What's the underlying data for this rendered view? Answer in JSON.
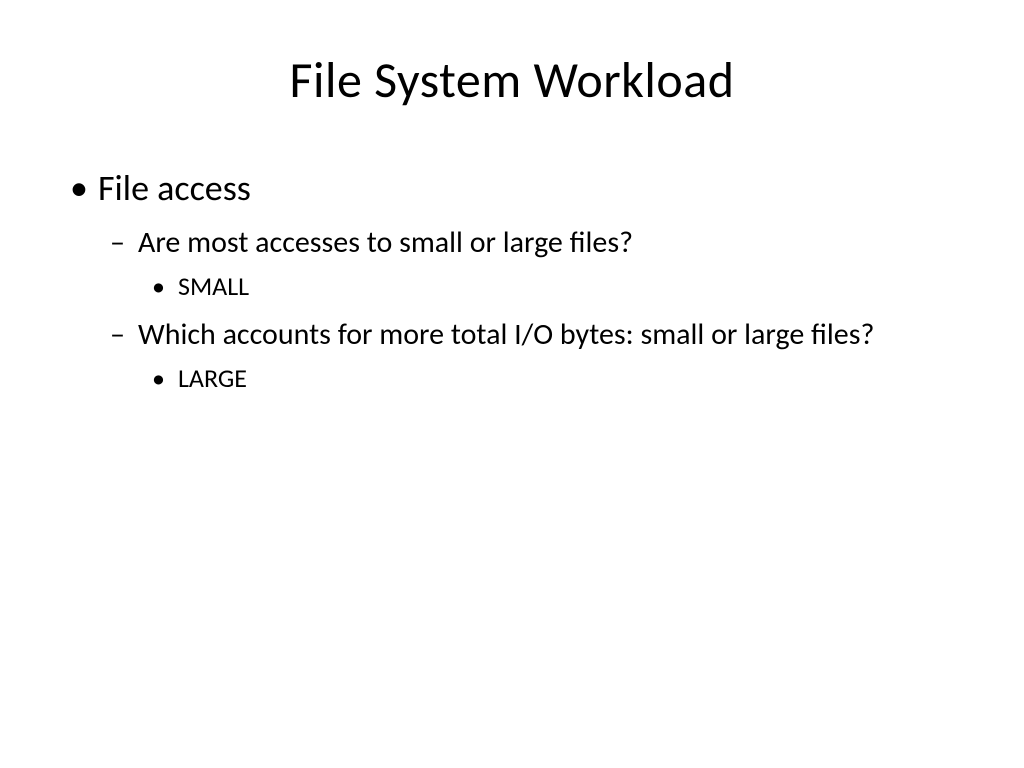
{
  "slide": {
    "title": "File System Workload",
    "bullets": {
      "item1": "File access",
      "item1_sub1": "Are most accesses to small or large files?",
      "item1_sub1_ans": "SMALL",
      "item1_sub2": "Which accounts for more total I/O bytes: small or large files?",
      "item1_sub2_ans": "LARGE"
    }
  }
}
